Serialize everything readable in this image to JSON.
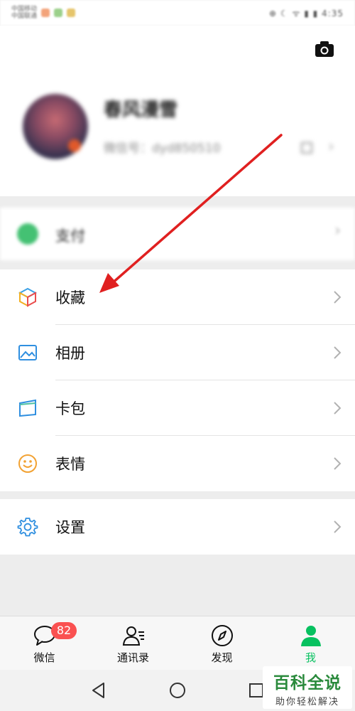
{
  "status_bar": {
    "carrier_line1": "中国移动",
    "carrier_line2": "中国联通",
    "right": "⊕ ☾ ᯤ ▮ ▮ 4:35"
  },
  "profile": {
    "nickname": "春风漫雪",
    "wechat_id": "微信号：dyd850510"
  },
  "pay": {
    "label": "支付"
  },
  "menu_group1": [
    {
      "label": "收藏",
      "icon": "favorites-cube-icon"
    },
    {
      "label": "相册",
      "icon": "album-icon"
    },
    {
      "label": "卡包",
      "icon": "card-wallet-icon"
    },
    {
      "label": "表情",
      "icon": "emoji-smile-icon"
    }
  ],
  "menu_group2": [
    {
      "label": "设置",
      "icon": "settings-gear-icon"
    }
  ],
  "tabbar": {
    "tabs": [
      {
        "label": "微信",
        "badge": "82",
        "active": false
      },
      {
        "label": "通讯录",
        "active": false
      },
      {
        "label": "发现",
        "active": false
      },
      {
        "label": "我",
        "active": true
      }
    ]
  },
  "watermark": {
    "main": "百科全说",
    "sub": "助你轻松解决"
  },
  "colors": {
    "accent": "#07c160",
    "badge": "#fa5151",
    "annotation_arrow": "#e02020"
  }
}
